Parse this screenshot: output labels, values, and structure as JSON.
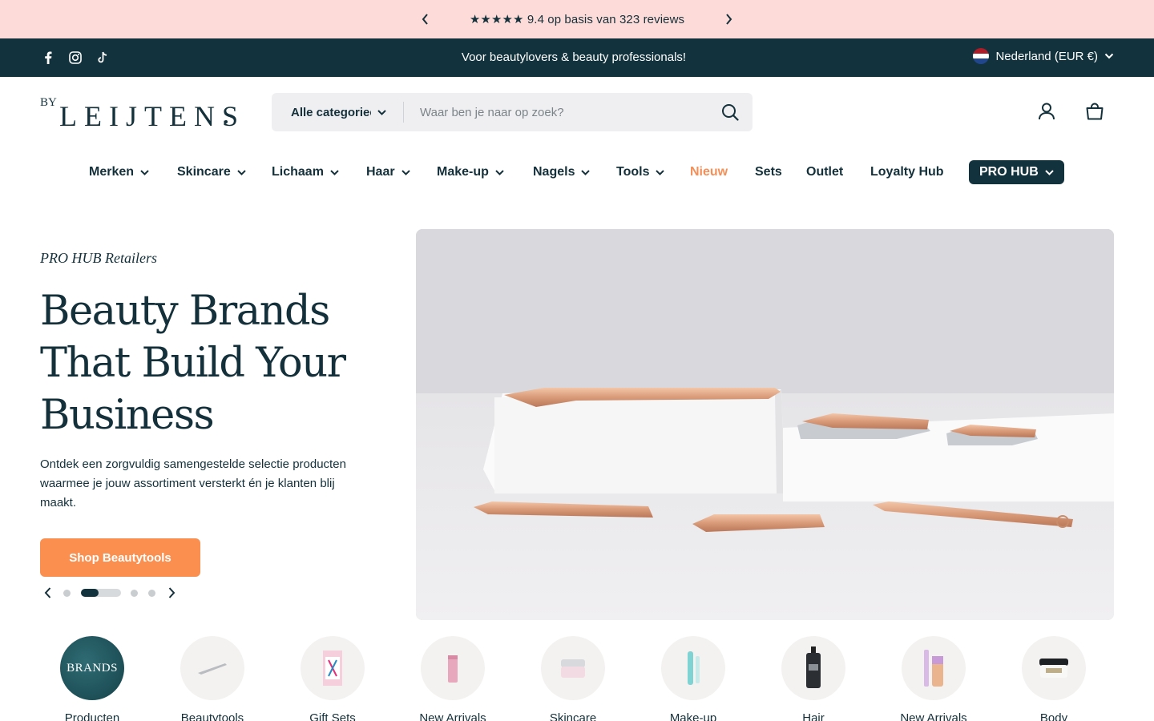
{
  "announcement": {
    "text": "★★★★★ 9.4 op basis van 323 reviews"
  },
  "topbar": {
    "tagline": "Voor beautylovers & beauty professionals!",
    "country": "Nederland (EUR €)"
  },
  "logo": {
    "by": "BY",
    "name": "LEIJTENS"
  },
  "search": {
    "category": "Alle categorieën",
    "placeholder": "Waar ben je naar op zoek?"
  },
  "nav": {
    "merken": "Merken",
    "skincare": "Skincare",
    "lichaam": "Lichaam",
    "haar": "Haar",
    "makeup": "Make-up",
    "nagels": "Nagels",
    "tools": "Tools",
    "nieuw": "Nieuw",
    "sets": "Sets",
    "outlet": "Outlet",
    "loyalty": "Loyalty Hub",
    "pro": "PRO HUB"
  },
  "hero": {
    "eyebrow": "PRO HUB Retailers",
    "title": "Beauty Brands That Build Your Business",
    "description": "Ontdek een zorgvuldig samengestelde selectie producten waarmee je jouw assortiment versterkt én je klanten blij maakt.",
    "button": "Shop Beautytools"
  },
  "categories": {
    "brands_badge": "BRANDS",
    "items": [
      {
        "label": "Producten",
        "icon": "brands-badge"
      },
      {
        "label": "Beautytools",
        "icon": "tweezer-icon"
      },
      {
        "label": "Gift Sets",
        "icon": "gift-set-icon"
      },
      {
        "label": "New Arrivals",
        "icon": "lipstick-icon"
      },
      {
        "label": "Skincare",
        "icon": "cream-jar-icon"
      },
      {
        "label": "Make-up",
        "icon": "mascara-icon"
      },
      {
        "label": "Hair",
        "icon": "hair-bottle-icon"
      },
      {
        "label": "New Arrivals",
        "icon": "concealer-icon"
      },
      {
        "label": "Body",
        "icon": "body-jar-icon"
      }
    ]
  },
  "colors": {
    "announcement_bg": "#fddbd8",
    "dark_teal": "#12333d",
    "accent_orange": "#fb8f4f",
    "nav_new": "#f48f57"
  }
}
